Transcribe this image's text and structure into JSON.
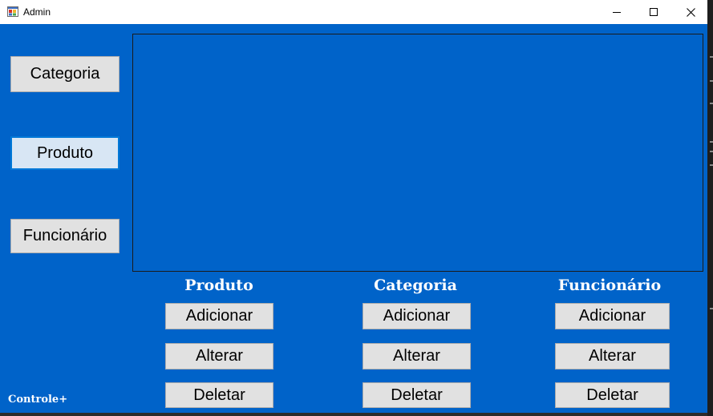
{
  "window": {
    "title": "Admin",
    "icon": "app-icon"
  },
  "sidebar": {
    "items": [
      {
        "label": "Categoria"
      },
      {
        "label": "Produto"
      },
      {
        "label": "Funcionário"
      }
    ]
  },
  "sections": [
    {
      "heading": "Produto",
      "add_label": "Adicionar",
      "edit_label": "Alterar",
      "delete_label": "Deletar"
    },
    {
      "heading": "Categoria",
      "add_label": "Adicionar",
      "edit_label": "Alterar",
      "delete_label": "Deletar"
    },
    {
      "heading": "Funcionário",
      "add_label": "Adicionar",
      "edit_label": "Alterar",
      "delete_label": "Deletar"
    }
  ],
  "footer": {
    "brand": "Controle+"
  },
  "colors": {
    "background": "#0063c9",
    "button_face": "#e1e1e1",
    "focus_accent": "#0078d7"
  }
}
